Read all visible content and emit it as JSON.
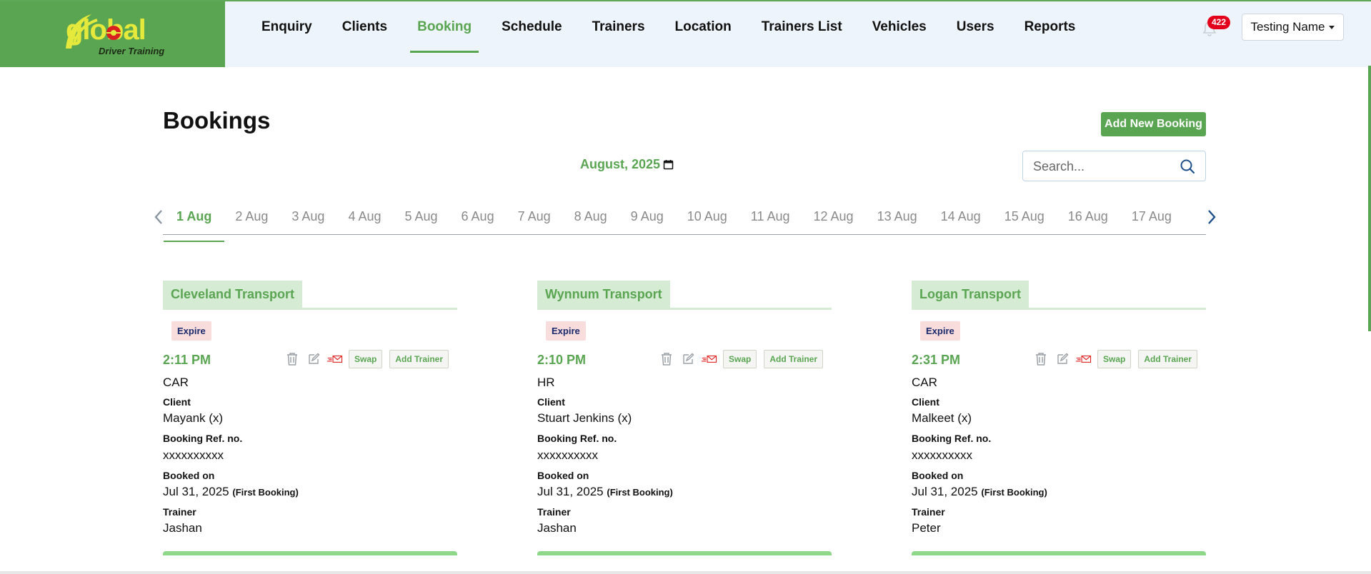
{
  "brand": {
    "logo_text": "global",
    "logo_subtext": "Driver Training",
    "color": "#5aa552"
  },
  "nav": {
    "items": [
      {
        "label": "Enquiry"
      },
      {
        "label": "Clients"
      },
      {
        "label": "Booking",
        "active": true
      },
      {
        "label": "Schedule"
      },
      {
        "label": "Trainers"
      },
      {
        "label": "Location"
      },
      {
        "label": "Trainers List"
      },
      {
        "label": "Vehicles"
      },
      {
        "label": "Users"
      },
      {
        "label": "Reports"
      }
    ]
  },
  "header": {
    "notification_count": "422",
    "user_name": "Testing Name"
  },
  "page": {
    "title": "Bookings",
    "add_button": "Add New Booking",
    "month_label": "August, 2025",
    "search_placeholder": "Search..."
  },
  "dates": [
    {
      "label": "1 Aug",
      "active": true
    },
    {
      "label": "2 Aug"
    },
    {
      "label": "3 Aug"
    },
    {
      "label": "4 Aug"
    },
    {
      "label": "5 Aug"
    },
    {
      "label": "6 Aug"
    },
    {
      "label": "7 Aug"
    },
    {
      "label": "8 Aug"
    },
    {
      "label": "9 Aug"
    },
    {
      "label": "10 Aug"
    },
    {
      "label": "11 Aug"
    },
    {
      "label": "12 Aug"
    },
    {
      "label": "13 Aug"
    },
    {
      "label": "14 Aug"
    },
    {
      "label": "15 Aug"
    },
    {
      "label": "16 Aug"
    },
    {
      "label": "17 Aug"
    }
  ],
  "labels": {
    "expire": "Expire",
    "swap": "Swap",
    "add_trainer": "Add Trainer",
    "client": "Client",
    "booking_ref": "Booking Ref. no.",
    "booked_on": "Booked on",
    "trainer": "Trainer",
    "first_booking": "(First Booking)"
  },
  "bookings": [
    {
      "location": "Cleveland Transport",
      "time": "2:11 PM",
      "vehicle": "CAR",
      "client": "Mayank (x)",
      "ref": "xxxxxxxxxx",
      "booked_on": "Jul 31, 2025",
      "trainer": "Jashan"
    },
    {
      "location": "Wynnum Transport",
      "time": "2:10 PM",
      "vehicle": "HR",
      "client": "Stuart Jenkins (x)",
      "ref": "xxxxxxxxxx",
      "booked_on": "Jul 31, 2025",
      "trainer": "Jashan"
    },
    {
      "location": "Logan Transport",
      "time": "2:31 PM",
      "vehicle": "CAR",
      "client": "Malkeet (x)",
      "ref": "xxxxxxxxxx",
      "booked_on": "Jul 31, 2025",
      "trainer": "Peter"
    }
  ],
  "icons": {
    "bell": "bell-icon",
    "calendar": "calendar-icon",
    "search": "search-icon",
    "prev": "chevron-left-icon",
    "next": "chevron-right-icon",
    "delete": "trash-icon",
    "edit": "edit-icon",
    "email": "send-email-icon"
  }
}
